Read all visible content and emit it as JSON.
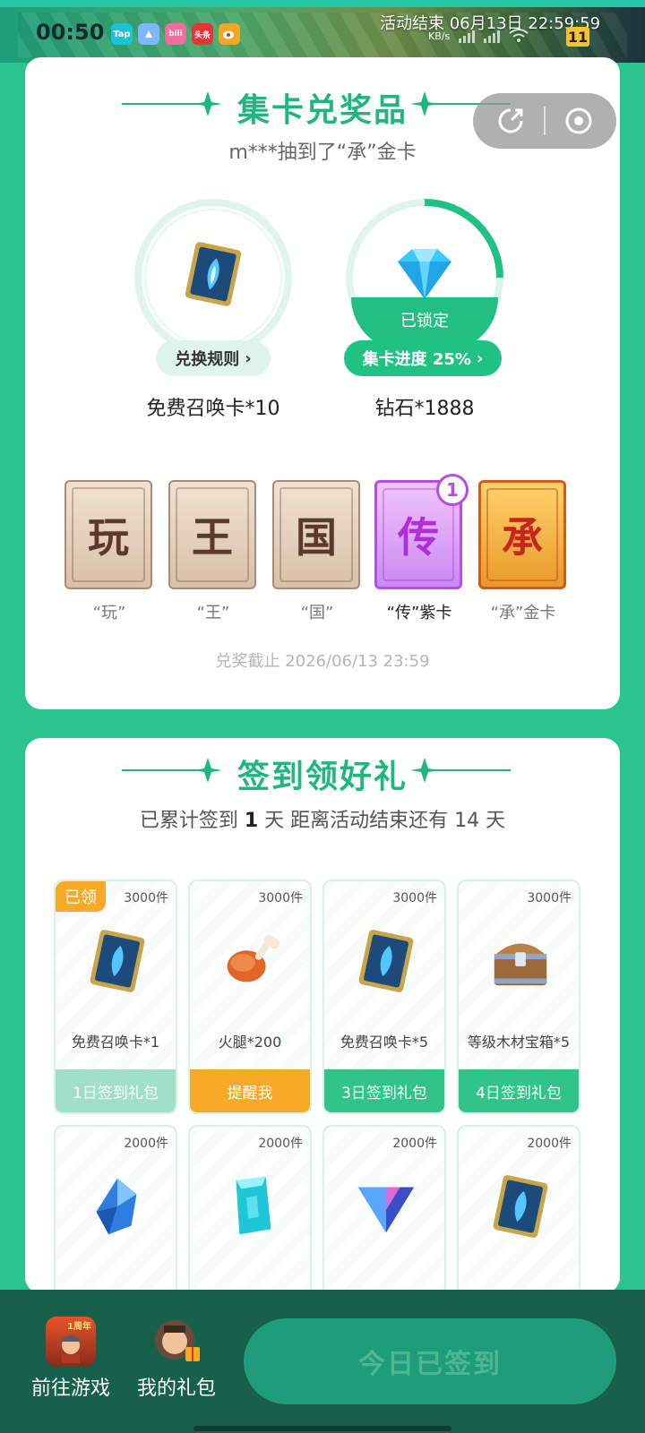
{
  "status_bar": {
    "time": "00:50",
    "event_end_text": "活动结束 06月13日 22:59:59",
    "net_speed": "KB/s",
    "battery": "11",
    "apps": [
      {
        "name": "taptap-app-icon",
        "label": "Tap",
        "color": "#19c3d8"
      },
      {
        "name": "mini-app-icon",
        "label": "",
        "color": "#7fb7ff"
      },
      {
        "name": "bilibili-app-icon",
        "label": "bili",
        "color": "#f26d9a"
      },
      {
        "name": "toutiao-app-icon",
        "label": "头条",
        "color": "#e8333b"
      },
      {
        "name": "weibo-app-icon",
        "label": "",
        "color": "#f5a623"
      }
    ]
  },
  "collect": {
    "title": "集卡兑奖品",
    "broadcast": "m***抽到了“承”金卡",
    "prizes": [
      {
        "name": "免费召唤卡*10",
        "pill": "兑换规则",
        "icon": "summon-card-icon"
      },
      {
        "name": "钻石*1888",
        "pill": "集卡进度 25%",
        "icon": "diamond-icon",
        "locked_label": "已锁定",
        "progress": 0.25
      }
    ],
    "cards": [
      {
        "char": "玩",
        "label": "“玩”",
        "style": "plain"
      },
      {
        "char": "王",
        "label": "“王”",
        "style": "plain"
      },
      {
        "char": "国",
        "label": "“国”",
        "style": "plain"
      },
      {
        "char": "传",
        "label": "“传”紫卡",
        "style": "purple",
        "badge": "1"
      },
      {
        "char": "承",
        "label": "“承”金卡",
        "style": "gold"
      }
    ],
    "deadline": "兑奖截止 2026/06/13 23:59"
  },
  "signin": {
    "title": "签到领好礼",
    "summary_prefix": "已累计签到",
    "summary_days": "1",
    "summary_suffix": "天  距离活动结束还有 14 天",
    "gifts": [
      {
        "stock": "3000件",
        "name": "免费召唤卡*1",
        "button": "1日签到礼包",
        "state": "done",
        "claimed": "已领",
        "icon": "summon-card-icon"
      },
      {
        "stock": "3000件",
        "name": "火腿*200",
        "button": "提醒我",
        "state": "remind",
        "icon": "ham-icon"
      },
      {
        "stock": "3000件",
        "name": "免费召唤卡*5",
        "button": "3日签到礼包",
        "state": "active",
        "icon": "summon-card-icon"
      },
      {
        "stock": "3000件",
        "name": "等级木材宝箱*5",
        "button": "4日签到礼包",
        "state": "active",
        "icon": "treasure-chest-icon"
      },
      {
        "stock": "2000件",
        "name": "",
        "button": "",
        "state": "active",
        "icon": "blue-crystal-icon"
      },
      {
        "stock": "2000件",
        "name": "",
        "button": "",
        "state": "active",
        "icon": "crystal-block-icon"
      },
      {
        "stock": "2000件",
        "name": "",
        "button": "",
        "state": "active",
        "icon": "shield-gem-icon"
      },
      {
        "stock": "2000件",
        "name": "",
        "button": "",
        "state": "active",
        "icon": "summon-card-icon"
      }
    ]
  },
  "bottom_bar": {
    "go_game": "前往游戏",
    "my_gifts": "我的礼包",
    "signed_button": "今日已签到",
    "game_badge": "1周年"
  },
  "colors": {
    "brand_green": "#20c283",
    "background": "#2bc38e",
    "bottom_bar": "#17604a",
    "remind_orange": "#f7a928",
    "purple_card": "#b64de8"
  }
}
